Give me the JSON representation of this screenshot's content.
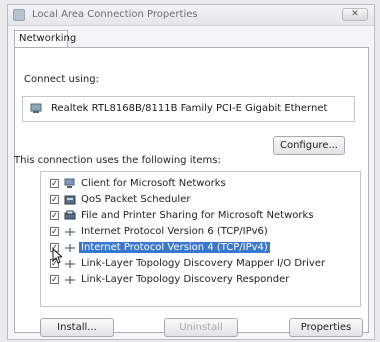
{
  "window": {
    "title": "Local Area Connection Properties",
    "close_glyph": "✕"
  },
  "tabs": [
    {
      "label": "Networking",
      "active": true
    }
  ],
  "connect_using": {
    "label": "Connect using:",
    "adapter": "Realtek RTL8168B/8111B Family PCI-E Gigabit Ethernet",
    "adapter_icon": "network-adapter-icon"
  },
  "configure_button": "Configure...",
  "items_caption": "This connection uses the following items:",
  "items": [
    {
      "label": "Client for Microsoft Networks",
      "checked": true,
      "icon": "network-client-icon",
      "selected": false
    },
    {
      "label": "QoS Packet Scheduler",
      "checked": true,
      "icon": "qos-scheduler-icon",
      "selected": false
    },
    {
      "label": "File and Printer Sharing for Microsoft Networks",
      "checked": true,
      "icon": "file-printer-sharing-icon",
      "selected": false
    },
    {
      "label": "Internet Protocol Version 6 (TCP/IPv6)",
      "checked": true,
      "icon": "protocol-icon",
      "selected": false
    },
    {
      "label": "Internet Protocol Version 4 (TCP/IPv4)",
      "checked": true,
      "icon": "protocol-icon",
      "selected": true
    },
    {
      "label": "Link-Layer Topology Discovery Mapper I/O Driver",
      "checked": true,
      "icon": "protocol-icon",
      "selected": false
    },
    {
      "label": "Link-Layer Topology Discovery Responder",
      "checked": true,
      "icon": "protocol-icon",
      "selected": false
    }
  ],
  "buttons": {
    "install": "Install...",
    "uninstall": "Uninstall",
    "properties": "Properties"
  },
  "colors": {
    "selection": "#3a77cf"
  }
}
